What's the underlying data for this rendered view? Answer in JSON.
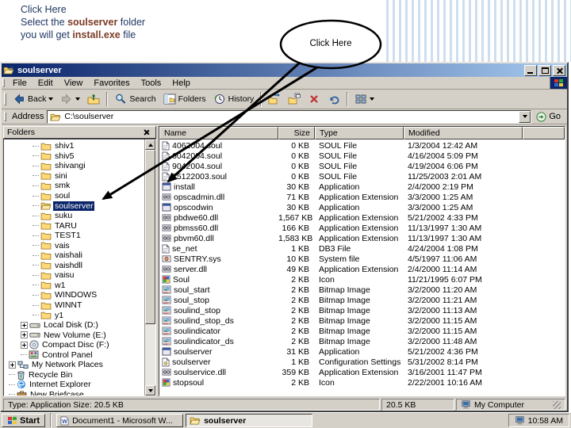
{
  "colors": {
    "titlebar_gradient_start": "#0a246a",
    "titlebar_gradient_end": "#a6caf0",
    "chrome": "#d4d0c8",
    "selection": "#0a246a",
    "annotation_text": "#1f3864",
    "annotation_bold": "#7b3a22"
  },
  "annotation": {
    "line1": "Click Here",
    "line2_prefix": "Select the ",
    "line2_bold": "soulserver",
    "line2_suffix": " folder",
    "line3_prefix": "you will get ",
    "line3_bold": "install.exe",
    "line3_suffix": " file",
    "callout_label": "Click Here"
  },
  "window": {
    "title": "soulserver",
    "menu": [
      "File",
      "Edit",
      "View",
      "Favorites",
      "Tools",
      "Help"
    ],
    "toolbar": {
      "items": [
        {
          "icon": "back-icon",
          "label": "Back",
          "dropdown": true
        },
        {
          "icon": "forward-icon",
          "label": "",
          "dropdown": true
        },
        {
          "icon": "up-icon",
          "label": ""
        },
        {
          "sep": true
        },
        {
          "icon": "search-icon",
          "label": "Search"
        },
        {
          "icon": "folders-icon",
          "label": "Folders"
        },
        {
          "icon": "history-icon",
          "label": "History"
        },
        {
          "sep": true
        },
        {
          "icon": "move-to-icon",
          "label": ""
        },
        {
          "icon": "copy-to-icon",
          "label": ""
        },
        {
          "icon": "delete-icon",
          "label": ""
        },
        {
          "icon": "undo-icon",
          "label": ""
        },
        {
          "sep": true
        },
        {
          "icon": "views-icon",
          "label": "",
          "dropdown": true
        }
      ]
    },
    "address": {
      "label": "Address",
      "value": "C:\\soulserver",
      "go_label": "Go"
    },
    "folders_panel": {
      "title": "Folders",
      "items": [
        {
          "label": "shiv1",
          "icon": "folder-icon",
          "depth": 2
        },
        {
          "label": "shiv5",
          "icon": "folder-icon",
          "depth": 2
        },
        {
          "label": "shivangi",
          "icon": "folder-icon",
          "depth": 2
        },
        {
          "label": "sini",
          "icon": "folder-icon",
          "depth": 2
        },
        {
          "label": "smk",
          "icon": "folder-icon",
          "depth": 2
        },
        {
          "label": "soul",
          "icon": "folder-icon",
          "depth": 2
        },
        {
          "label": "soulserver",
          "icon": "open-folder-icon",
          "depth": 2,
          "selected": true
        },
        {
          "label": "suku",
          "icon": "folder-icon",
          "depth": 2
        },
        {
          "label": "TARU",
          "icon": "folder-icon",
          "depth": 2
        },
        {
          "label": "TEST1",
          "icon": "folder-icon",
          "depth": 2
        },
        {
          "label": "vais",
          "icon": "folder-icon",
          "depth": 2
        },
        {
          "label": "vaishali",
          "icon": "folder-icon",
          "depth": 2
        },
        {
          "label": "vaishdll",
          "icon": "folder-icon",
          "depth": 2
        },
        {
          "label": "vaisu",
          "icon": "folder-icon",
          "depth": 2
        },
        {
          "label": "w1",
          "icon": "folder-icon",
          "depth": 2
        },
        {
          "label": "WINDOWS",
          "icon": "folder-icon",
          "depth": 2
        },
        {
          "label": "WINNT",
          "icon": "folder-icon",
          "depth": 2
        },
        {
          "label": "y1",
          "icon": "folder-icon",
          "depth": 2
        },
        {
          "label": "Local Disk (D:)",
          "icon": "drive-icon",
          "depth": 1,
          "plus": true
        },
        {
          "label": "New Volume (E:)",
          "icon": "drive-icon",
          "depth": 1,
          "plus": true
        },
        {
          "label": "Compact Disc (F:)",
          "icon": "cd-icon",
          "depth": 1,
          "plus": true
        },
        {
          "label": "Control Panel",
          "icon": "control-panel-icon",
          "depth": 1
        },
        {
          "label": "My Network Places",
          "icon": "network-icon",
          "depth": 0,
          "plus": true
        },
        {
          "label": "Recycle Bin",
          "icon": "recycle-bin-icon",
          "depth": 0
        },
        {
          "label": "Internet Explorer",
          "icon": "ie-icon",
          "depth": 0
        },
        {
          "label": "New Briefcase",
          "icon": "briefcase-icon",
          "depth": 0
        }
      ]
    },
    "file_list": {
      "columns": [
        "Name",
        "Size",
        "Type",
        "Modified"
      ],
      "rows": [
        {
          "name": "4062004.soul",
          "size": "0 KB",
          "type": "SOUL File",
          "modified": "1/3/2004 12:42 AM",
          "icon": "document-icon"
        },
        {
          "name": "6042004.soul",
          "size": "0 KB",
          "type": "SOUL File",
          "modified": "4/16/2004 5:09 PM",
          "icon": "document-icon"
        },
        {
          "name": "9042004.soul",
          "size": "0 KB",
          "type": "SOUL File",
          "modified": "4/19/2004 6:06 PM",
          "icon": "document-icon"
        },
        {
          "name": "25122003.soul",
          "size": "0 KB",
          "type": "SOUL File",
          "modified": "11/25/2003 2:01 AM",
          "icon": "document-icon"
        },
        {
          "name": "install",
          "size": "30 KB",
          "type": "Application",
          "modified": "2/4/2000 2:19 PM",
          "icon": "application-icon"
        },
        {
          "name": "opscadmin.dll",
          "size": "71 KB",
          "type": "Application Extension",
          "modified": "3/3/2000 1:25 AM",
          "icon": "dll-icon"
        },
        {
          "name": "opscodwin",
          "size": "30 KB",
          "type": "Application",
          "modified": "3/3/2000 1:25 AM",
          "icon": "application-icon"
        },
        {
          "name": "pbdwe60.dll",
          "size": "1,567 KB",
          "type": "Application Extension",
          "modified": "5/21/2002 4:33 PM",
          "icon": "dll-icon"
        },
        {
          "name": "pbmss60.dll",
          "size": "166 KB",
          "type": "Application Extension",
          "modified": "11/13/1997 1:30 AM",
          "icon": "dll-icon"
        },
        {
          "name": "pbvm60.dll",
          "size": "1,583 KB",
          "type": "Application Extension",
          "modified": "11/13/1997 1:30 AM",
          "icon": "dll-icon"
        },
        {
          "name": "se_net",
          "size": "1 KB",
          "type": "DB3 File",
          "modified": "4/24/2004 1:08 PM",
          "icon": "document-icon"
        },
        {
          "name": "SENTRY.sys",
          "size": "10 KB",
          "type": "System file",
          "modified": "4/5/1997 11:06 AM",
          "icon": "sys-icon"
        },
        {
          "name": "server.dll",
          "size": "49 KB",
          "type": "Application Extension",
          "modified": "2/4/2000 11:14 AM",
          "icon": "dll-icon"
        },
        {
          "name": "Soul",
          "size": "2 KB",
          "type": "Icon",
          "modified": "11/21/1995 6:07 PM",
          "icon": "icon-file-icon"
        },
        {
          "name": "soul_start",
          "size": "2 KB",
          "type": "Bitmap Image",
          "modified": "3/2/2000 11:20 AM",
          "icon": "bitmap-icon"
        },
        {
          "name": "soul_stop",
          "size": "2 KB",
          "type": "Bitmap Image",
          "modified": "3/2/2000 11:21 AM",
          "icon": "bitmap-icon"
        },
        {
          "name": "soulind_stop",
          "size": "2 KB",
          "type": "Bitmap Image",
          "modified": "3/2/2000 11:13 AM",
          "icon": "bitmap-icon"
        },
        {
          "name": "soulind_stop_ds",
          "size": "2 KB",
          "type": "Bitmap Image",
          "modified": "3/2/2000 11:15 AM",
          "icon": "bitmap-icon"
        },
        {
          "name": "soulindicator",
          "size": "2 KB",
          "type": "Bitmap Image",
          "modified": "3/2/2000 11:15 AM",
          "icon": "bitmap-icon"
        },
        {
          "name": "soulindicator_ds",
          "size": "2 KB",
          "type": "Bitmap Image",
          "modified": "3/2/2000 11:48 AM",
          "icon": "bitmap-icon"
        },
        {
          "name": "soulserver",
          "size": "31 KB",
          "type": "Application",
          "modified": "5/21/2002 4:36 PM",
          "icon": "application-icon"
        },
        {
          "name": "soulserver",
          "size": "1 KB",
          "type": "Configuration Settings",
          "modified": "5/31/2002 8:14 PM",
          "icon": "config-icon"
        },
        {
          "name": "soulservice.dll",
          "size": "359 KB",
          "type": "Application Extension",
          "modified": "3/16/2001 11:47 PM",
          "icon": "dll-icon"
        },
        {
          "name": "stopsoul",
          "size": "2 KB",
          "type": "Icon",
          "modified": "2/22/2001 10:16 AM",
          "icon": "icon-file-icon"
        }
      ]
    },
    "status_bar": {
      "left": "Type: Application  Size: 20.5 KB",
      "center": "20.5 KB",
      "right": "My Computer"
    }
  },
  "taskbar": {
    "start_label": "Start",
    "tasks": [
      {
        "icon": "word-doc-icon",
        "label": "Document1 - Microsoft W...",
        "active": false
      },
      {
        "icon": "open-folder-icon",
        "label": "soulserver",
        "active": true
      }
    ],
    "clock": "10:58 AM"
  }
}
